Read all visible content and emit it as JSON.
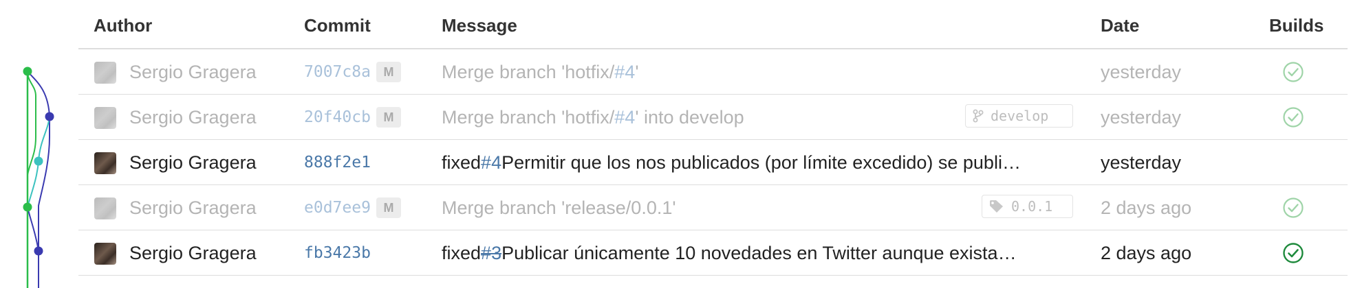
{
  "headers": {
    "author": "Author",
    "commit": "Commit",
    "message": "Message",
    "date": "Date",
    "builds": "Builds"
  },
  "colors": {
    "issue_link": "#4a78a8",
    "build_success": "#1e8a3c",
    "graph_green": "#2bbd4a",
    "graph_teal": "#3cc2bf",
    "graph_navy": "#3a3ab0"
  },
  "rows": [
    {
      "author": "Sergio Gragera",
      "sha": "7007c8a",
      "merge_badge": "M",
      "message_prefix": "Merge branch 'hotfix/",
      "issue": "#4",
      "message_suffix": "'",
      "ref": "",
      "date": "yesterday",
      "build": "success-check-icon"
    },
    {
      "author": "Sergio Gragera",
      "sha": "20f40cb",
      "merge_badge": "M",
      "message_prefix": "Merge branch 'hotfix/",
      "issue": "#4",
      "message_suffix": "' into develop",
      "ref": "develop",
      "ref_icon": "branch-icon",
      "date": "yesterday",
      "build": "success-check-icon"
    },
    {
      "author": "Sergio Gragera",
      "sha": "888f2e1",
      "message_prefix": "fixed ",
      "issue": "#4",
      "message_suffix": " Permitir que los nos publicados (por límite excedido) se publi…",
      "date": "yesterday",
      "build": ""
    },
    {
      "author": "Sergio Gragera",
      "sha": "e0d7ee9",
      "merge_badge": "M",
      "message_prefix": "Merge branch 'release/0.0.1'",
      "ref": "0.0.1",
      "ref_icon": "tag-icon",
      "date": "2 days ago",
      "build": "success-check-icon"
    },
    {
      "author": "Sergio Gragera",
      "sha": "fb3423b",
      "message_prefix": "fixed ",
      "issue": "#3",
      "issue_closed": true,
      "message_suffix": " Publicar únicamente 10 novedades en Twitter aunque exista…",
      "date": "2 days ago",
      "build": "success-check-icon"
    }
  ]
}
